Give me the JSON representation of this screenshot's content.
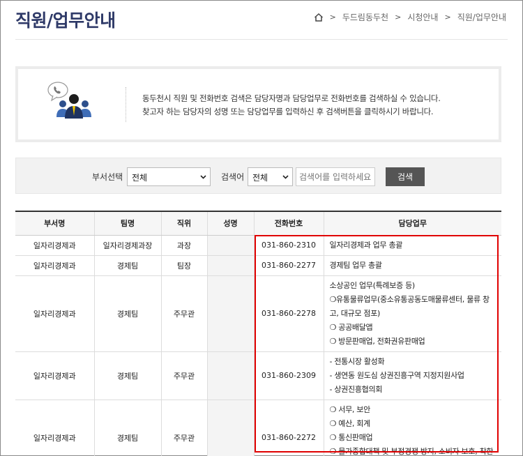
{
  "header": {
    "title": "직원/업무안내",
    "breadcrumb": [
      "두드림동두천",
      "시청안내",
      "직원/업무안내"
    ]
  },
  "info": {
    "line1": "동두천시 직원 및 전화번호 검색은 담당자명과 담당업무로 전화번호를 검색하실 수 있습니다.",
    "line2": "찾고자 하는 담당자의 성명 또는 담당업무를 입력하신 후 검색버튼을 클릭하시기 바랍니다."
  },
  "search": {
    "dept_label": "부서선택",
    "dept_value": "전체",
    "keyword_label": "검색어",
    "keyword_type_value": "전체",
    "placeholder": "검색어를 입력하세요",
    "button_label": "검색"
  },
  "table": {
    "columns": [
      "부서명",
      "팀명",
      "직위",
      "성명",
      "전화번호",
      "담당업무"
    ],
    "rows": [
      {
        "dept": "일자리경제과",
        "team": "일자리경제과장",
        "position": "과장",
        "name": "",
        "phone": "031-860-2310",
        "duties": [
          "일자리경제과 업무 총괄"
        ]
      },
      {
        "dept": "일자리경제과",
        "team": "경제팀",
        "position": "팀장",
        "name": "",
        "phone": "031-860-2277",
        "duties": [
          "경제팀 업무 총괄"
        ]
      },
      {
        "dept": "일자리경제과",
        "team": "경제팀",
        "position": "주무관",
        "name": "",
        "phone": "031-860-2278",
        "duties": [
          "소상공인 업무(특례보증 등)",
          "❍유통물류업무(중소유통공동도매물류센터, 물류 창고, 대규모 점포)",
          "❍ 공공배달앱",
          "❍ 방문판매업, 전화권유판매업"
        ]
      },
      {
        "dept": "일자리경제과",
        "team": "경제팀",
        "position": "주무관",
        "name": "",
        "phone": "031-860-2309",
        "duties": [
          "- 전통시장 활성화",
          "- 생연동 원도심 상권진흥구역 지정지원사업",
          "- 상권진흥협의회"
        ]
      },
      {
        "dept": "일자리경제과",
        "team": "경제팀",
        "position": "주무관",
        "name": "",
        "phone": "031-860-2272",
        "duties": [
          "❍ 서무, 보안",
          "❍ 예산, 회계",
          "❍ 통신판매업",
          "❍ 물가종합대책 및 부정경쟁 방지, 소비자 보호, 착한 가격업소, 소비자정책 위원회"
        ]
      }
    ]
  },
  "colors": {
    "title": "#2f3a68",
    "highlight": "#e00000",
    "button": "#555555"
  }
}
